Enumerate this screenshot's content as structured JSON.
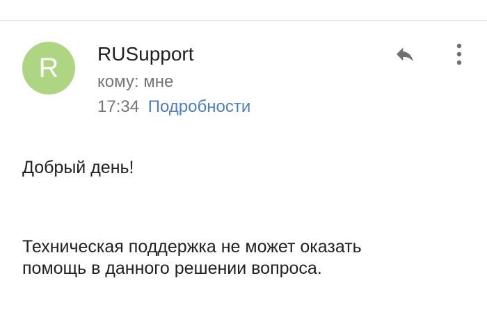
{
  "email": {
    "avatar_letter": "R",
    "avatar_color": "#aed581",
    "sender": "RUSupport",
    "recipient": "кому: мне",
    "time": "17:34",
    "details_link": "Подробности",
    "accent_color": "#4a7ec9",
    "icons": {
      "reply": "reply-icon",
      "more": "more-vert-icon"
    }
  },
  "body": {
    "greeting": "Добрый день!",
    "message_line1": "Техническая поддержка не может оказать",
    "message_line2": "помощь в данного решении вопроса."
  }
}
